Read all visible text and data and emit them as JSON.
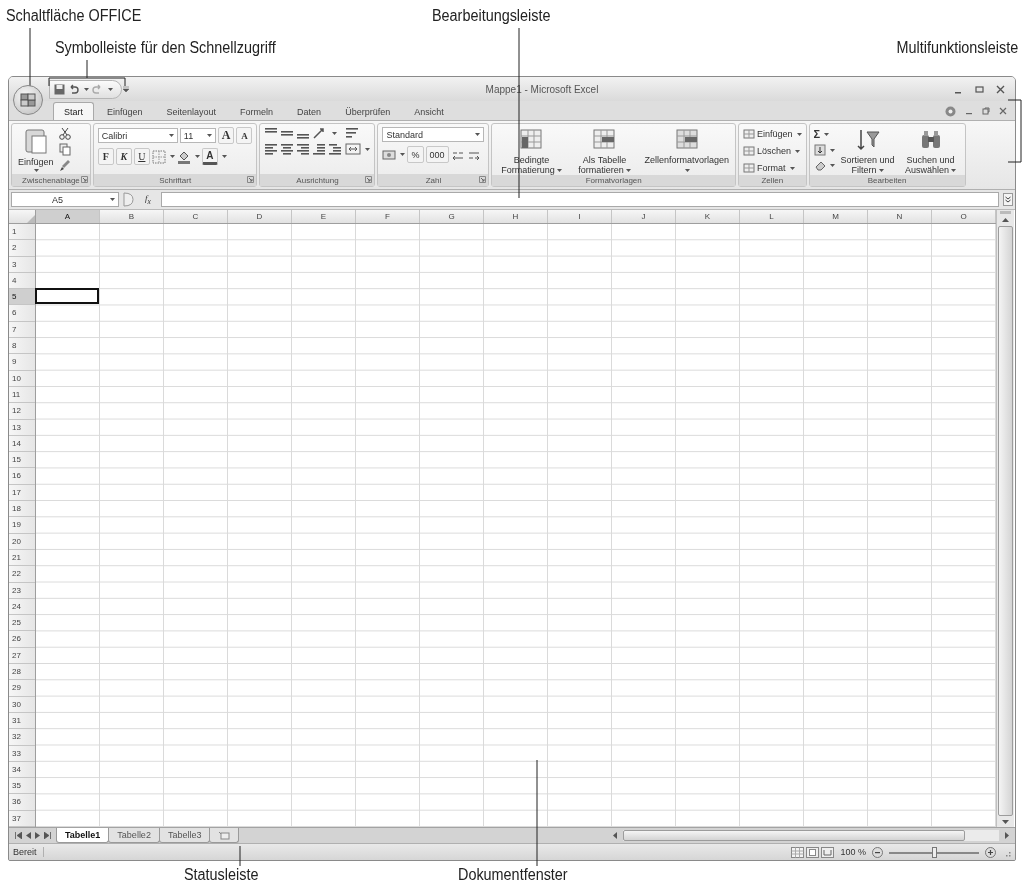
{
  "callouts": [
    {
      "text": "Schaltfläche OFFICE"
    },
    {
      "text": "Symbolleiste für den Schnellzugriff"
    },
    {
      "text": "Bearbeitungsleiste"
    },
    {
      "text": "Multifunktionsleiste"
    },
    {
      "text": "Statusleiste"
    },
    {
      "text": "Dokumentfenster"
    }
  ],
  "window": {
    "title": "Mappe1 - Microsoft Excel"
  },
  "tabs": [
    {
      "label": "Start",
      "selected": true
    },
    {
      "label": "Einfügen",
      "selected": false
    },
    {
      "label": "Seitenlayout",
      "selected": false
    },
    {
      "label": "Formeln",
      "selected": false
    },
    {
      "label": "Daten",
      "selected": false
    },
    {
      "label": "Überprüfen",
      "selected": false
    },
    {
      "label": "Ansicht",
      "selected": false
    }
  ],
  "ribbon": {
    "groups": [
      {
        "kind": "clipboard",
        "label": "Zwischenablage",
        "launcher": true,
        "paste": "Einfügen"
      },
      {
        "kind": "font",
        "label": "Schriftart",
        "launcher": true,
        "font": "Calibri",
        "size": "11",
        "size_buttons": [
          "A",
          "A"
        ],
        "style_buttons": [
          "F",
          "K",
          "U"
        ],
        "color_button": "A"
      },
      {
        "kind": "alignment",
        "label": "Ausrichtung",
        "launcher": true
      },
      {
        "kind": "number",
        "label": "Zahl",
        "launcher": true,
        "format": "Standard",
        "symbols": [
          "%",
          "000"
        ]
      },
      {
        "kind": "styles",
        "label": "Formatvorlagen",
        "launcher": false,
        "buttons": [
          "Bedingte Formatierung",
          "Als Tabelle formatieren",
          "Zellenformatvorlagen"
        ]
      },
      {
        "kind": "cells",
        "label": "Zellen",
        "launcher": false,
        "buttons": [
          "Einfügen",
          "Löschen",
          "Format"
        ]
      },
      {
        "kind": "editing",
        "label": "Bearbeiten",
        "launcher": false,
        "sum": "Σ",
        "buttons": [
          "Sortieren und Filtern",
          "Suchen und Auswählen"
        ]
      }
    ]
  },
  "formula_bar": {
    "name_box": "A5",
    "function_label": "f$_{x}$"
  },
  "columns": [
    {
      "label": "A",
      "active": true
    },
    {
      "label": "B",
      "active": false
    },
    {
      "label": "C",
      "active": false
    },
    {
      "label": "D",
      "active": false
    },
    {
      "label": "E",
      "active": false
    },
    {
      "label": "F",
      "active": false
    },
    {
      "label": "G",
      "active": false
    },
    {
      "label": "H",
      "active": false
    },
    {
      "label": "I",
      "active": false
    },
    {
      "label": "J",
      "active": false
    },
    {
      "label": "K",
      "active": false
    },
    {
      "label": "L",
      "active": false
    },
    {
      "label": "M",
      "active": false
    },
    {
      "label": "N",
      "active": false
    },
    {
      "label": "O",
      "active": false
    }
  ],
  "rows": [
    {
      "label": "1",
      "active": false
    },
    {
      "label": "2",
      "active": false
    },
    {
      "label": "3",
      "active": false
    },
    {
      "label": "4",
      "active": false
    },
    {
      "label": "5",
      "active": true
    },
    {
      "label": "6",
      "active": false
    },
    {
      "label": "7",
      "active": false
    },
    {
      "label": "8",
      "active": false
    },
    {
      "label": "9",
      "active": false
    },
    {
      "label": "10",
      "active": false
    },
    {
      "label": "11",
      "active": false
    },
    {
      "label": "12",
      "active": false
    },
    {
      "label": "13",
      "active": false
    },
    {
      "label": "14",
      "active": false
    },
    {
      "label": "15",
      "active": false
    },
    {
      "label": "16",
      "active": false
    },
    {
      "label": "17",
      "active": false
    },
    {
      "label": "18",
      "active": false
    },
    {
      "label": "19",
      "active": false
    },
    {
      "label": "20",
      "active": false
    },
    {
      "label": "21",
      "active": false
    },
    {
      "label": "22",
      "active": false
    },
    {
      "label": "23",
      "active": false
    },
    {
      "label": "24",
      "active": false
    },
    {
      "label": "25",
      "active": false
    },
    {
      "label": "26",
      "active": false
    },
    {
      "label": "27",
      "active": false
    },
    {
      "label": "28",
      "active": false
    },
    {
      "label": "29",
      "active": false
    },
    {
      "label": "30",
      "active": false
    },
    {
      "label": "31",
      "active": false
    },
    {
      "label": "32",
      "active": false
    },
    {
      "label": "33",
      "active": false
    },
    {
      "label": "34",
      "active": false
    },
    {
      "label": "35",
      "active": false
    },
    {
      "label": "36",
      "active": false
    },
    {
      "label": "37",
      "active": false
    }
  ],
  "sheet_tabs": [
    {
      "label": "Tabelle1",
      "selected": true
    },
    {
      "label": "Tabelle2",
      "selected": false
    },
    {
      "label": "Tabelle3",
      "selected": false
    }
  ],
  "status_bar": {
    "text": "Bereit",
    "zoom": "100 %",
    "level": 0.5
  }
}
